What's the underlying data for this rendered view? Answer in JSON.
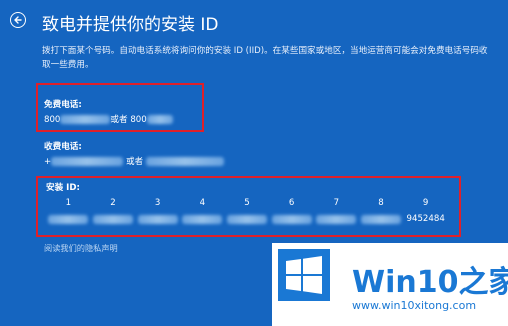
{
  "header": {
    "title": "致电并提供你的安装 ID"
  },
  "description": "拨打下面某个号码。自动电话系统将询问你的安装 ID (IID)。在某些国家或地区，当地运营商可能会对免费电话号码收取一些费用。",
  "free_phone": {
    "label": "免费电话:",
    "number_prefix_1": "800",
    "connector": "或者",
    "number_prefix_2": "800"
  },
  "paid_phone": {
    "label": "收费电话:",
    "number_prefix_1": "+",
    "connector": "或者"
  },
  "install_id": {
    "label": "安装 ID:",
    "groups": [
      "1",
      "2",
      "3",
      "4",
      "5",
      "6",
      "7",
      "8",
      "9"
    ],
    "last_value": "9452484"
  },
  "privacy_link": "阅读我们的隐私声明",
  "watermark": {
    "brand": "Win10",
    "brand_suffix": "之家",
    "url": "www.win10xitong.com"
  },
  "colors": {
    "background": "#1565c0",
    "highlight_box": "#e0202a",
    "logo_blue": "#1a78d4"
  }
}
